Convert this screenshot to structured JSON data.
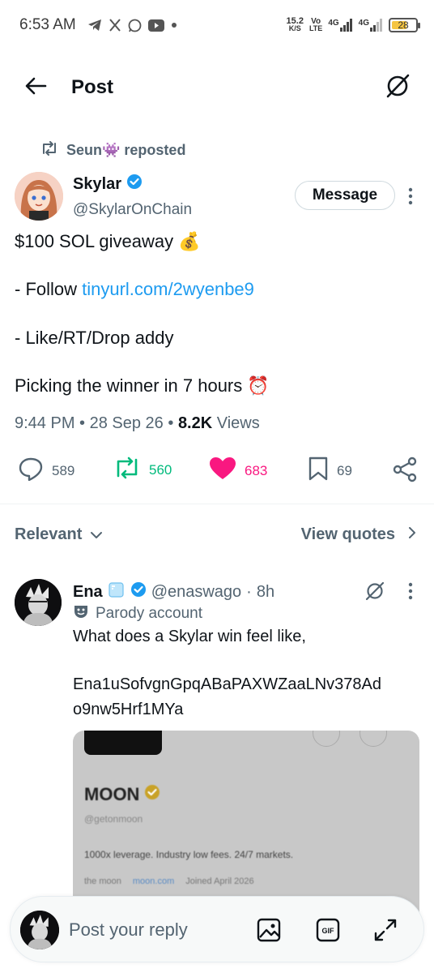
{
  "status_bar": {
    "time": "6:53 AM",
    "speed_top": "15.2",
    "speed_bottom": "K/S",
    "volte_top": "Vo",
    "volte_bottom": "LTE",
    "net1": "4G",
    "net2": "4G",
    "battery": "28"
  },
  "header": {
    "title": "Post"
  },
  "repost": {
    "label": "Seun👾 reposted"
  },
  "post": {
    "author_name": "Skylar",
    "author_handle": "@SkylarOnChain",
    "message_button": "Message",
    "line1": "$100 SOL giveaway 💰",
    "line2_prefix": "- Follow ",
    "line2_link": "tinyurl.com/2wyenbe9",
    "line3": "- Like/RT/Drop addy",
    "line4": "Picking the winner in 7 hours ⏰",
    "time": "9:44 PM",
    "date": "28 Sep 26",
    "views_count": "8.2K",
    "views_label": "Views",
    "replies": "589",
    "reposts": "560",
    "likes": "683",
    "bookmarks": "69"
  },
  "sort": {
    "left_label": "Relevant",
    "right_label": "View quotes"
  },
  "reply": {
    "name": "Ena",
    "handle": "@enaswago",
    "time": "8h",
    "parody_label": "Parody account",
    "line1": "What does a Skylar win feel like,",
    "line2": "Ena1uSofvgnGpqABaPAXWZaaLNv378Ad",
    "line3": "o9nw5Hrf1MYa",
    "media": {
      "name": "MOON",
      "handle": "@getonmoon",
      "bio": "1000x leverage. Industry low fees. 24/7 markets.",
      "meta1": "the moon",
      "meta2": "moon.com",
      "meta3": "Joined April 2026"
    }
  },
  "reply_bar": {
    "placeholder": "Post your reply"
  },
  "colors": {
    "accent": "#1d9bf0",
    "repost_green": "#00ba7c",
    "like_pink": "#f91880",
    "muted": "#536471"
  }
}
